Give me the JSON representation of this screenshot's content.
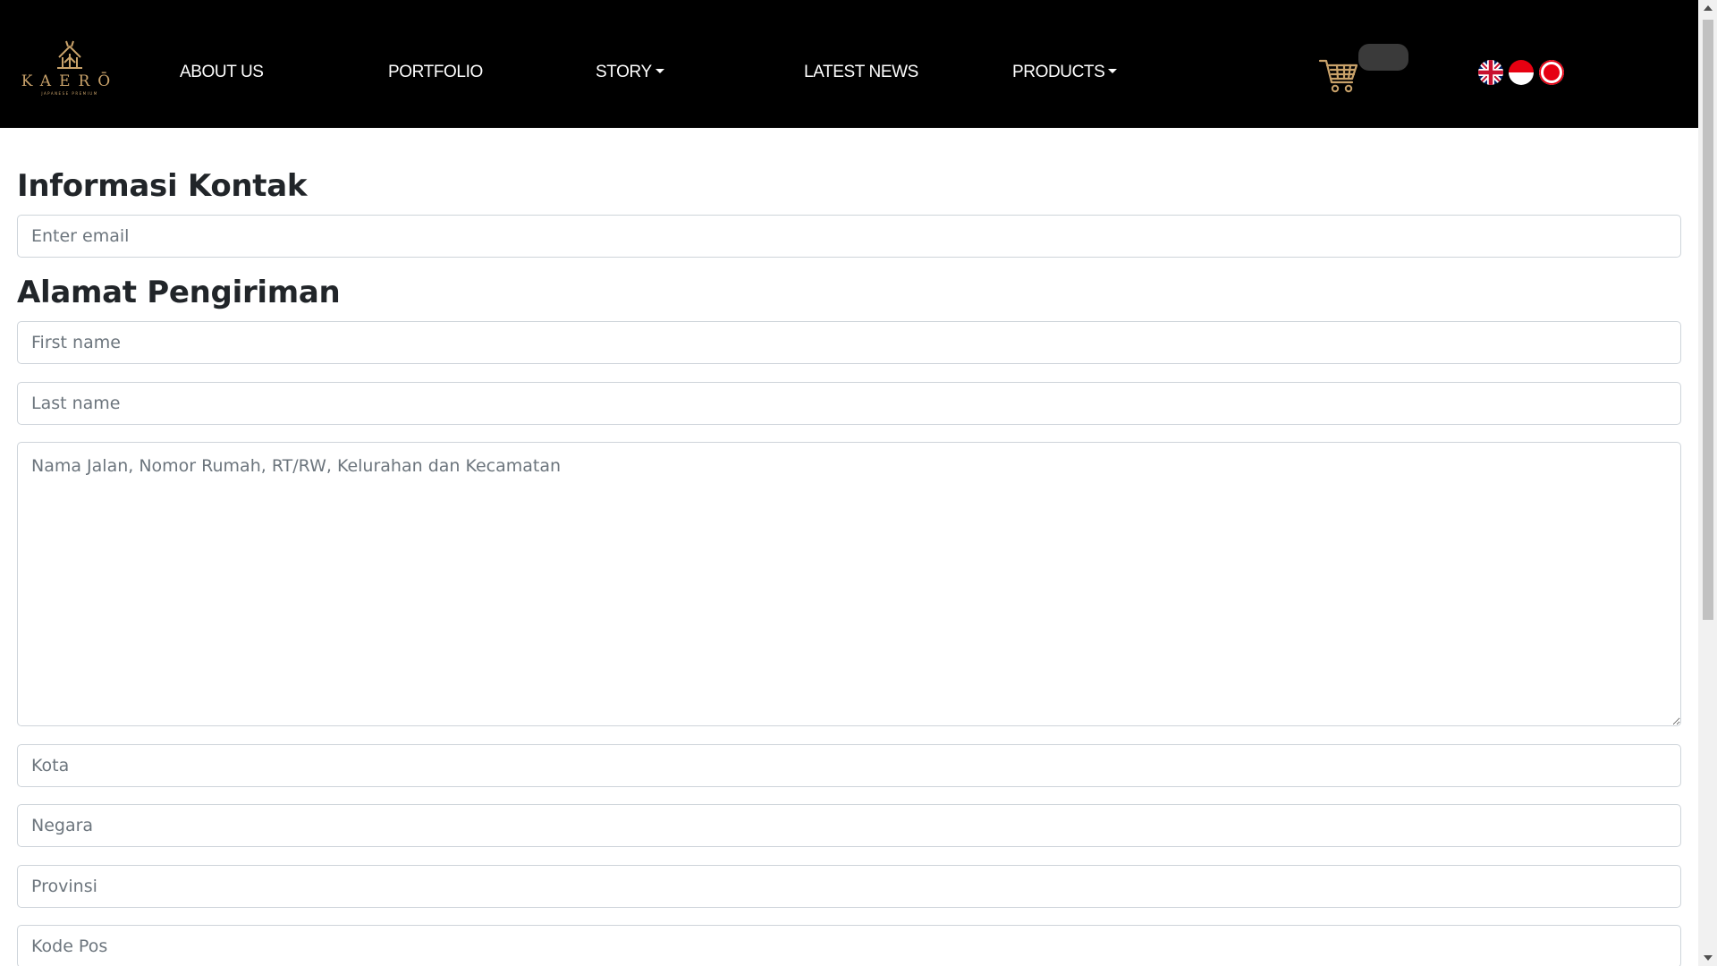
{
  "navbar": {
    "logo_text": "KAERŌ",
    "logo_tagline": "JAPANESE PREMIUM",
    "links": [
      {
        "label": "ABOUT US"
      },
      {
        "label": "PORTFOLIO"
      },
      {
        "label": "STORY"
      },
      {
        "label": "LATEST NEWS"
      },
      {
        "label": "PRODUCTS"
      }
    ],
    "cart_icon": "cart-icon",
    "languages": [
      "english-flag-icon",
      "indonesia-flag-icon",
      "japan-flag-icon"
    ]
  },
  "contact": {
    "heading": "Informasi Kontak",
    "email_placeholder": "Enter email"
  },
  "shipping": {
    "heading": "Alamat Pengiriman",
    "first_name_placeholder": "First name",
    "last_name_placeholder": "Last name",
    "address_placeholder": "Nama Jalan, Nomor Rumah, RT/RW, Kelurahan dan Kecamatan",
    "city_placeholder": "Kota",
    "country_placeholder": "Negara",
    "province_placeholder": "Provinsi",
    "postal_placeholder": "Kode Pos"
  },
  "colors": {
    "navbar_bg": "#000000",
    "logo_gold": "#c9a26a",
    "input_border": "#ced4da",
    "placeholder": "#6c757d",
    "heading": "#212529"
  }
}
